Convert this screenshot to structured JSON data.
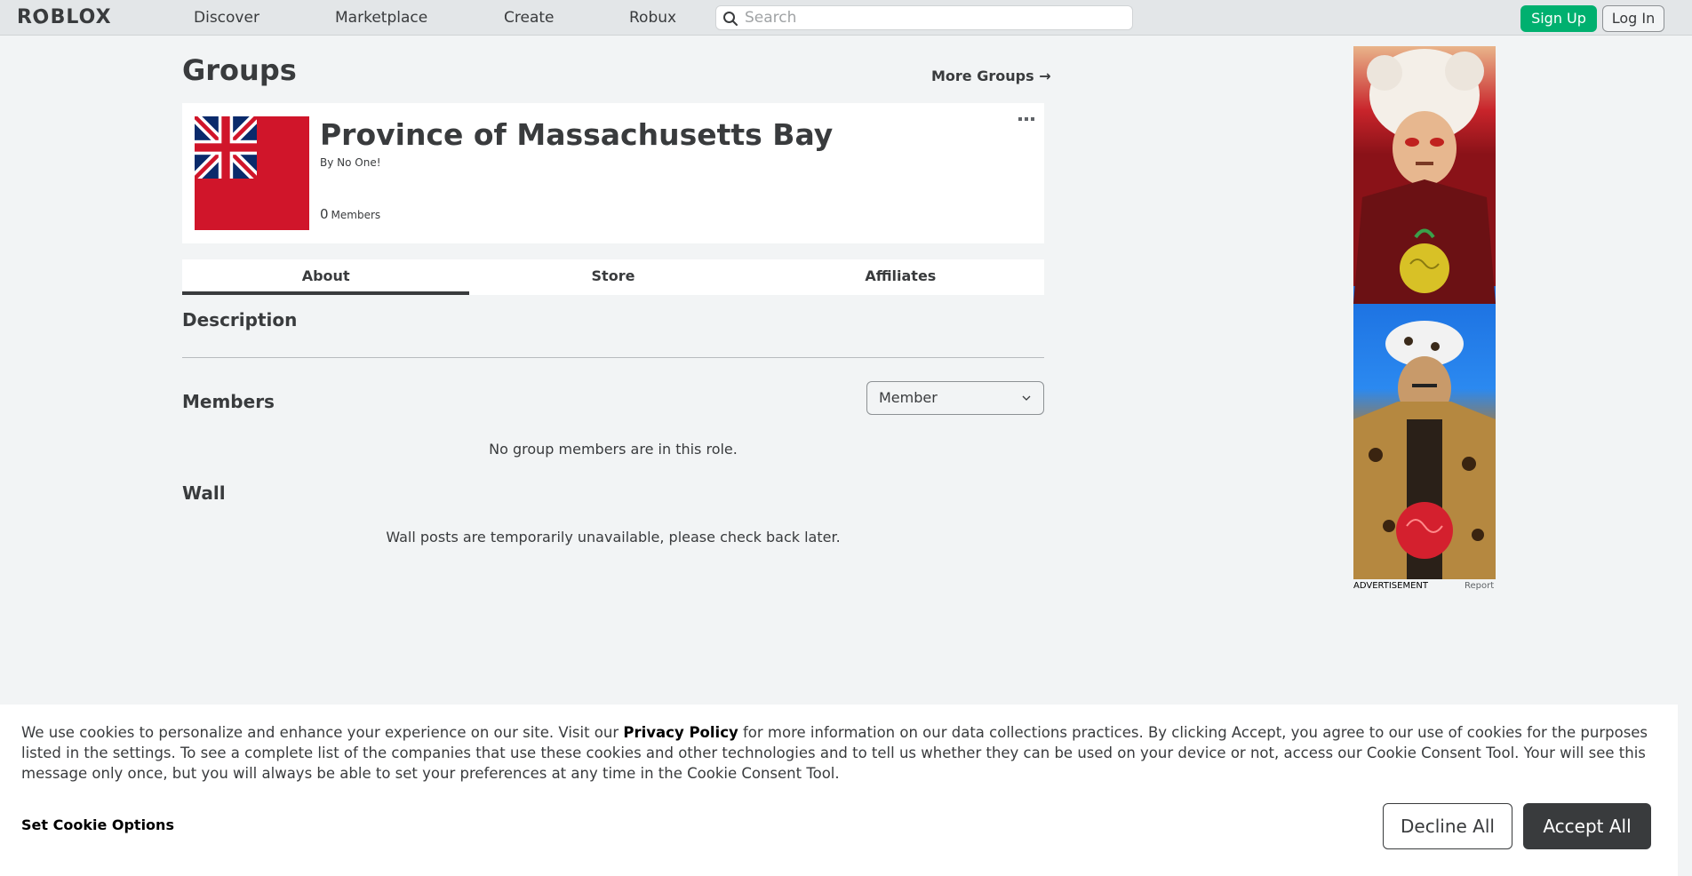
{
  "nav": {
    "logo": "ROBLOX",
    "links": [
      "Discover",
      "Marketplace",
      "Create",
      "Robux"
    ],
    "search_placeholder": "Search",
    "signup_label": "Sign Up",
    "login_label": "Log In"
  },
  "page": {
    "title": "Groups",
    "more_groups": "More Groups"
  },
  "group": {
    "name": "Province of Massachusetts Bay",
    "owner": "By No One!",
    "member_count": "0",
    "member_label": "Members"
  },
  "tabs": [
    "About",
    "Store",
    "Affiliates"
  ],
  "active_tab": "About",
  "sections": {
    "description_heading": "Description",
    "members_heading": "Members",
    "role_selected": "Member",
    "no_members_msg": "No group members are in this role.",
    "wall_heading": "Wall",
    "wall_msg": "Wall posts are temporarily unavailable, please check back later."
  },
  "ad": {
    "label": "ADVERTISEMENT",
    "report": "Report"
  },
  "cookie": {
    "text_before": "We use cookies to personalize and enhance your experience on our site. Visit our ",
    "privacy_link": "Privacy Policy",
    "text_after": " for more information on our data collections practices. By clicking Accept, you agree to our use of cookies for the purposes listed in the settings. To see a complete list of the companies that use these cookies and other technologies and to tell us whether they can be used on your device or not, access our Cookie Consent Tool. Your will see this message only once, but you will always be able to set your preferences at any time in the Cookie Consent Tool.",
    "set_options": "Set Cookie Options",
    "decline": "Decline All",
    "accept": "Accept All"
  },
  "colors": {
    "signup_green": "#00b06f",
    "flag_red": "#d0152a",
    "flag_blue": "#0a2a6b",
    "accept_dark": "#393b3d"
  }
}
